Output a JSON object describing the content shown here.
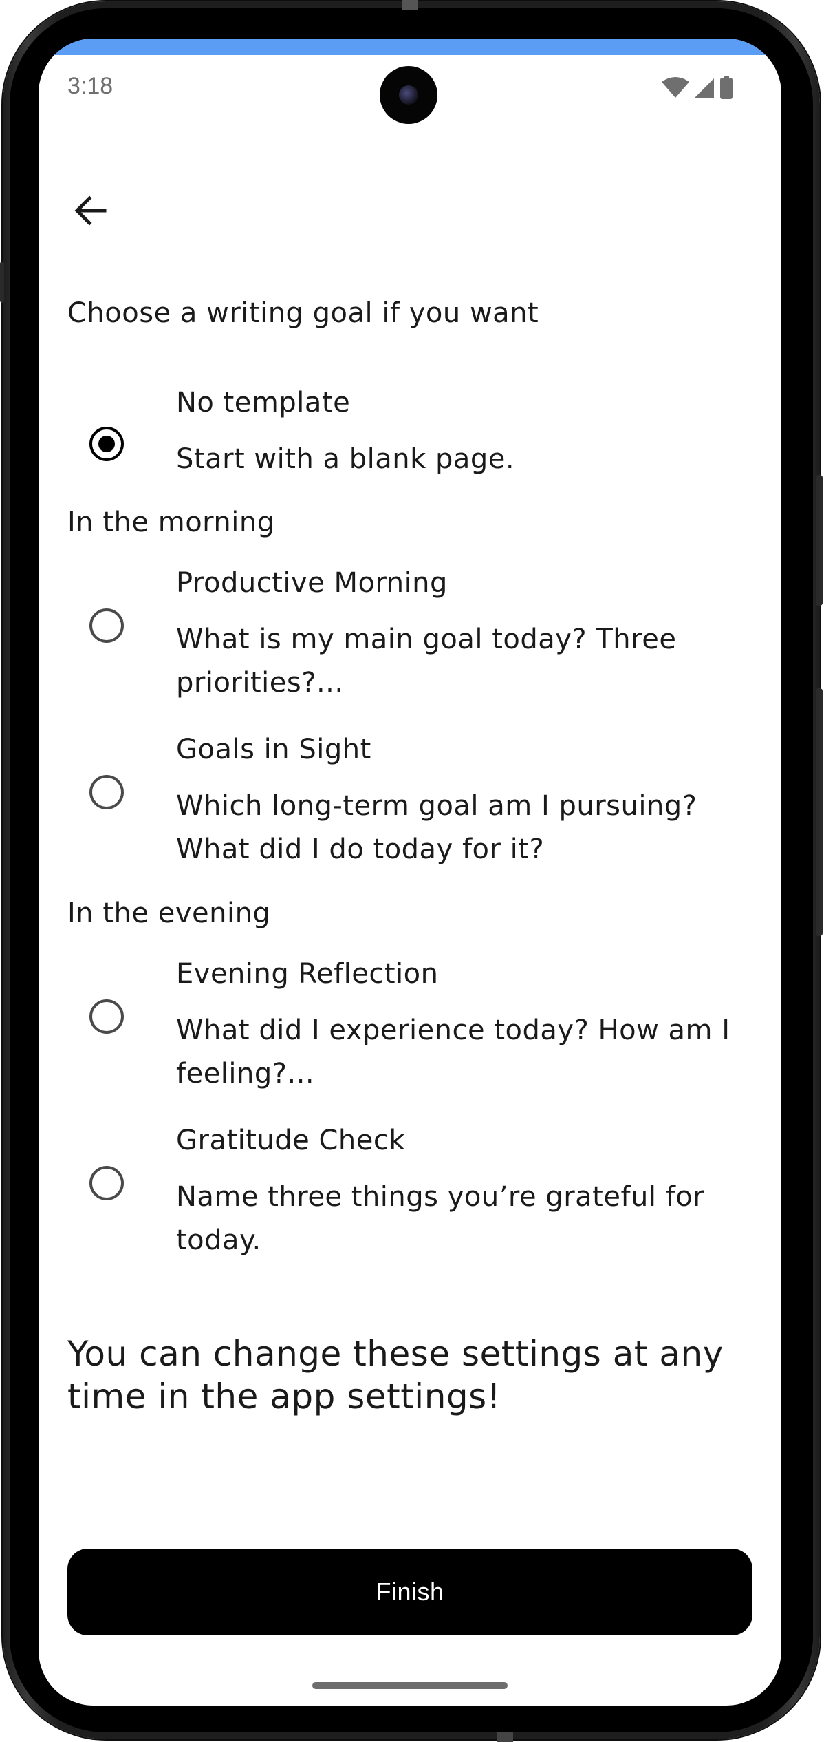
{
  "status_bar": {
    "time": "3:18"
  },
  "header": {
    "prompt": "Choose a writing goal if you want"
  },
  "options": [
    {
      "title": "No template",
      "description": "Start with a blank page.",
      "selected": true
    }
  ],
  "sections": [
    {
      "label": "In the morning",
      "options": [
        {
          "title": "Productive Morning",
          "description": "What is my main goal today? Three priorities?...",
          "selected": false
        },
        {
          "title": "Goals in Sight",
          "description": "Which long-term goal am I pursuing? What did I do today for it?",
          "selected": false
        }
      ]
    },
    {
      "label": "In the evening",
      "options": [
        {
          "title": "Evening Reflection",
          "description": "What did I experience today? How am I feeling?...",
          "selected": false
        },
        {
          "title": "Gratitude Check",
          "description": "Name three things you’re grateful for today.",
          "selected": false
        }
      ]
    }
  ],
  "footer_note": "You can change these settings at any time in the app settings!",
  "finish_button": {
    "label": "Finish"
  },
  "colors": {
    "accent_bar": "#5b9cf5",
    "button_background": "#000000",
    "button_text": "#ffffff",
    "text": "#1a1a1a"
  },
  "icons": {
    "back": "arrow-left-icon",
    "wifi": "wifi-icon",
    "signal": "cell-signal-icon",
    "battery": "battery-icon"
  }
}
